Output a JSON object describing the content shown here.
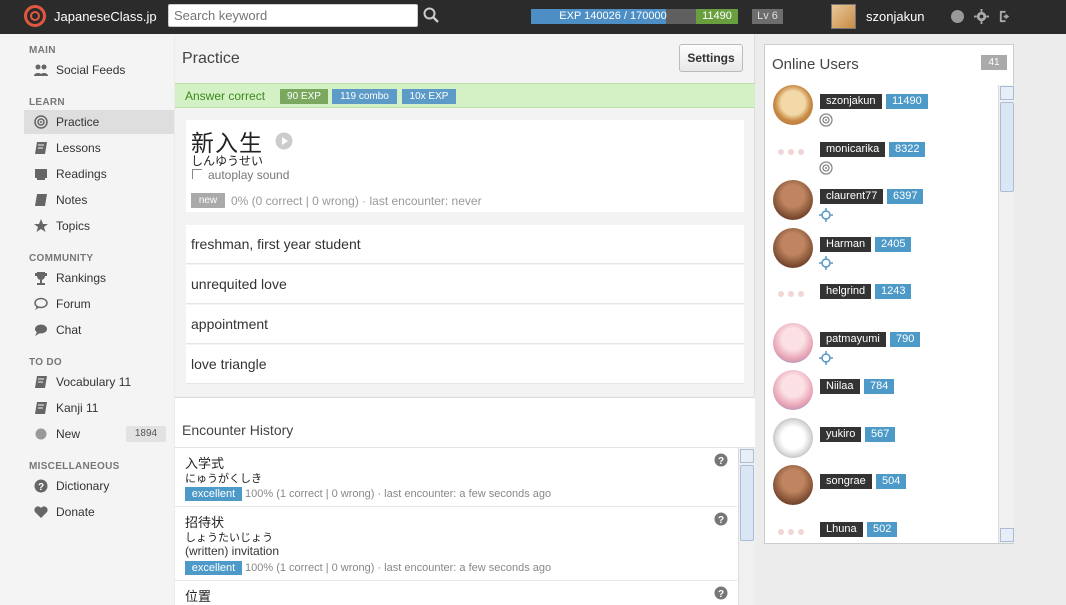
{
  "header": {
    "site_name": "JapaneseClass.jp",
    "search_placeholder": "Search keyword",
    "exp_text": "EXP 140026 / 170000",
    "exp_progress": 0.8237,
    "score": "11490",
    "level": "Lv 6",
    "username": "szonjakun",
    "colors": {
      "brand": "#e2583e",
      "exp": "#4d8fc4",
      "score": "#6a9f3f"
    }
  },
  "sidebar": {
    "sections": [
      {
        "title": "MAIN",
        "items": [
          {
            "label": "Social Feeds",
            "icon": "people-icon"
          }
        ]
      },
      {
        "title": "LEARN",
        "items": [
          {
            "label": "Practice",
            "icon": "target-icon",
            "active": true
          },
          {
            "label": "Lessons",
            "icon": "book-icon"
          },
          {
            "label": "Readings",
            "icon": "reading-icon"
          },
          {
            "label": "Notes",
            "icon": "notes-icon"
          },
          {
            "label": "Topics",
            "icon": "star-icon"
          }
        ]
      },
      {
        "title": "COMMUNITY",
        "items": [
          {
            "label": "Rankings",
            "icon": "trophy-icon"
          },
          {
            "label": "Forum",
            "icon": "forum-icon"
          },
          {
            "label": "Chat",
            "icon": "chat-icon"
          }
        ]
      },
      {
        "title": "TO DO",
        "items": [
          {
            "label": "Vocabulary 11",
            "icon": "book-icon"
          },
          {
            "label": "Kanji 11",
            "icon": "book-icon"
          },
          {
            "label": "New",
            "icon": "circle-icon",
            "badge": "1894"
          }
        ]
      },
      {
        "title": "MISCELLANEOUS",
        "items": [
          {
            "label": "Dictionary",
            "icon": "help-icon"
          },
          {
            "label": "Donate",
            "icon": "heart-icon"
          }
        ]
      }
    ]
  },
  "practice": {
    "title": "Practice",
    "settings_label": "Settings",
    "answer_status": "Answer correct",
    "tags": [
      "90 EXP",
      "119 combo",
      "10x EXP"
    ],
    "word": {
      "kanji": "新入生",
      "kana": "しんゆうせい",
      "autoplay_label": "autoplay sound",
      "status_badge": "new",
      "stats": "0% (0 correct | 0 wrong) · last encounter: never"
    },
    "answers": [
      "freshman, first year student",
      "unrequited love",
      "appointment",
      "love triangle"
    ]
  },
  "history": {
    "title": "Encounter History",
    "entries": [
      {
        "kanji": "入学式",
        "kana": "にゅうがくしき",
        "meaning": "",
        "badge": "excellent",
        "stats": "100% (1 correct | 0 wrong) · last encounter: a few seconds ago"
      },
      {
        "kanji": "招待状",
        "kana": "しょうたいじょう",
        "meaning": "(written) invitation",
        "badge": "excellent",
        "stats": "100% (1 correct | 0 wrong) · last encounter: a few seconds ago"
      },
      {
        "kanji": "位置",
        "kana": "",
        "meaning": "",
        "badge": "",
        "stats": ""
      }
    ]
  },
  "online_users": {
    "title": "Online Users",
    "count": "41",
    "users": [
      {
        "name": "szonjakun",
        "score": "11490",
        "avatar": "shiba",
        "status_icon": "target-icon"
      },
      {
        "name": "monicarika",
        "score": "8322",
        "avatar": "none",
        "status_icon": "target-icon"
      },
      {
        "name": "claurent77",
        "score": "6397",
        "avatar": "photo",
        "status_icon": "crosshair-icon"
      },
      {
        "name": "Harman",
        "score": "2405",
        "avatar": "photo",
        "status_icon": "crosshair-icon"
      },
      {
        "name": "helgrind",
        "score": "1243",
        "avatar": "none",
        "status_icon": ""
      },
      {
        "name": "patmayumi",
        "score": "790",
        "avatar": "anime",
        "status_icon": "crosshair-icon"
      },
      {
        "name": "Niilaa",
        "score": "784",
        "avatar": "anime",
        "status_icon": ""
      },
      {
        "name": "yukiro",
        "score": "567",
        "avatar": "sketch",
        "status_icon": ""
      },
      {
        "name": "songrae",
        "score": "504",
        "avatar": "photo",
        "status_icon": ""
      },
      {
        "name": "Lhuna",
        "score": "502",
        "avatar": "none",
        "status_icon": ""
      }
    ]
  }
}
